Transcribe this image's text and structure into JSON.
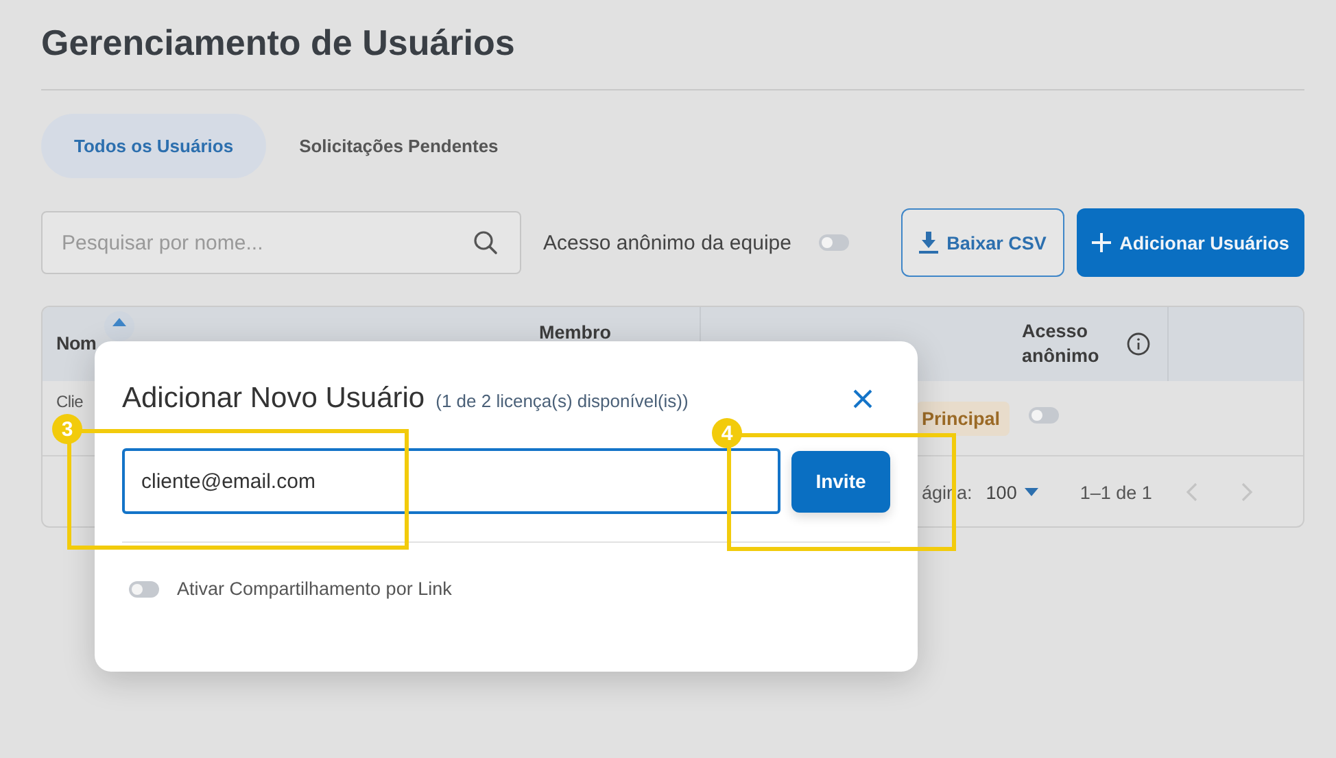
{
  "page": {
    "title": "Gerenciamento de Usuários"
  },
  "tabs": [
    {
      "label": "Todos os Usuários",
      "selected": true
    },
    {
      "label": "Solicitações Pendentes",
      "selected": false
    }
  ],
  "toolbar": {
    "search": {
      "placeholder": "Pesquisar por nome..."
    },
    "anonymous_toggle": {
      "label": "Acesso anônimo da equipe",
      "on": false
    },
    "buttons": [
      {
        "label": "Baixar CSV",
        "kind": "outline"
      },
      {
        "label": "Adicionar Usuários",
        "kind": "primary"
      }
    ]
  },
  "table": {
    "columns": [
      {
        "label": "Nom",
        "kind": "sort"
      },
      {
        "label": "Membro",
        "kind": "plain"
      },
      {
        "label": "Acesso anônimo",
        "kind": "info"
      }
    ],
    "row": {
      "name": "Clie",
      "type": "Principal",
      "anonymous_access": false
    },
    "footer": {
      "rows_per_page_label": "ágina:",
      "rows_per_page": "100",
      "range": "1–1 de 1"
    }
  },
  "dialog": {
    "title": "Adicionar Novo Usuário",
    "subtitle": "(1 de 2 licença(s) disponível(is))",
    "email": {
      "value": "cliente@email.com"
    },
    "invite_button": "Invite",
    "link_sharing": {
      "label": "Ativar Compartilhamento por Link",
      "on": false
    }
  },
  "annotations": [
    {
      "label": "3"
    },
    {
      "label": "4"
    }
  ]
}
